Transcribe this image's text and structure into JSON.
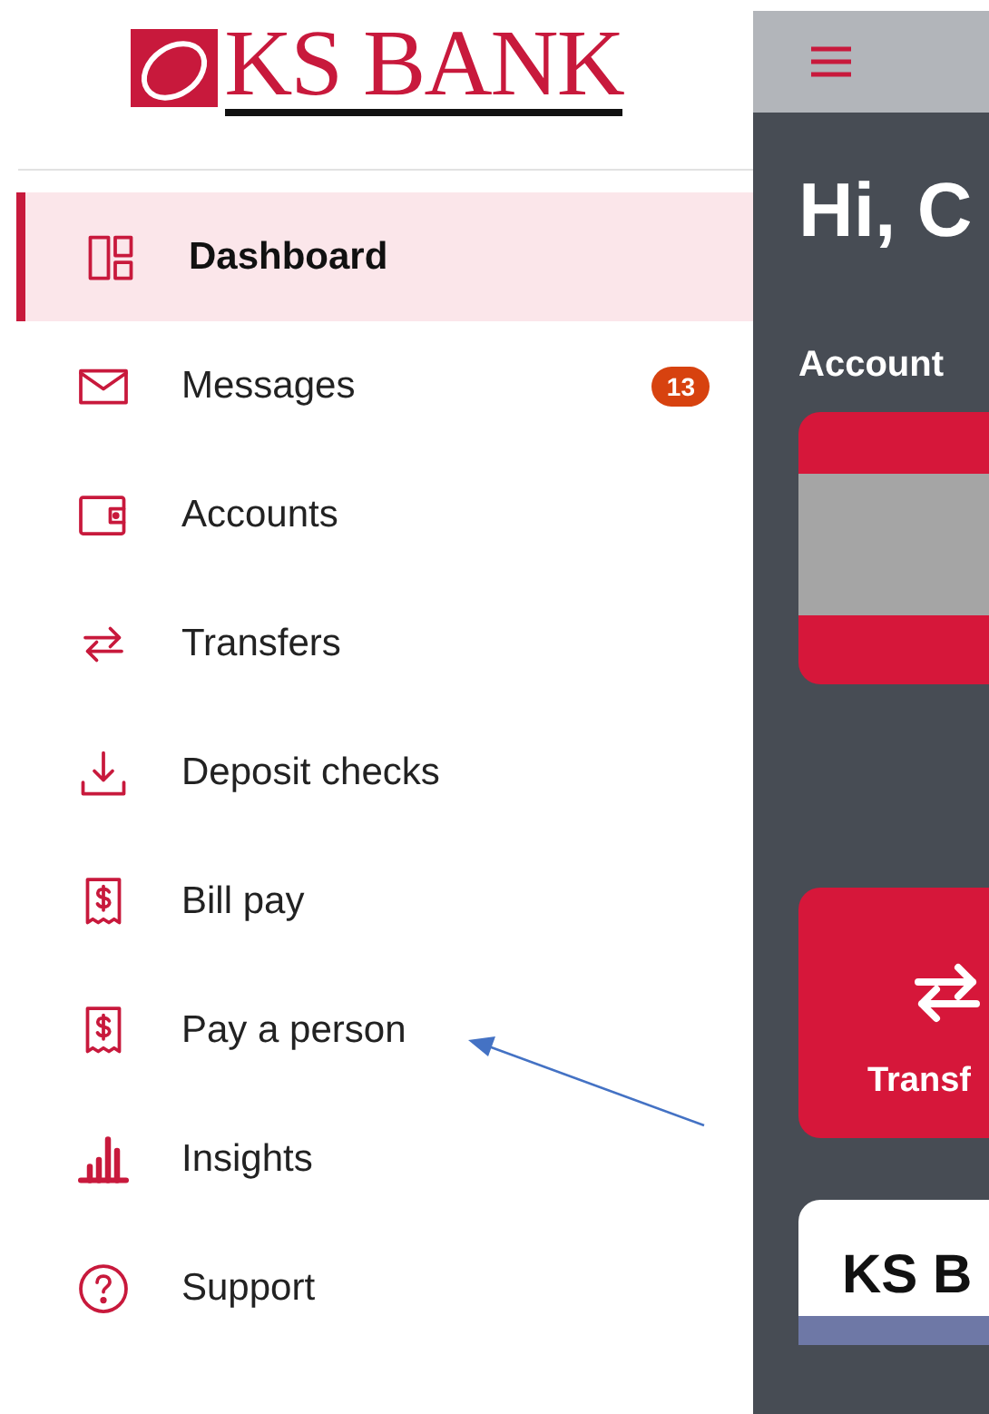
{
  "logo": {
    "text": "KS BANK"
  },
  "menu": [
    {
      "label": "Dashboard",
      "selected": true
    },
    {
      "label": "Messages",
      "selected": false,
      "badge": "13"
    },
    {
      "label": "Accounts",
      "selected": false
    },
    {
      "label": "Transfers",
      "selected": false
    },
    {
      "label": "Deposit checks",
      "selected": false
    },
    {
      "label": "Bill pay",
      "selected": false
    },
    {
      "label": "Pay a person",
      "selected": false
    },
    {
      "label": "Insights",
      "selected": false
    },
    {
      "label": "Support",
      "selected": false
    }
  ],
  "background_app": {
    "greeting": "Hi, C",
    "section_title": "Account",
    "action_button": {
      "label": "Transf"
    },
    "card_title": "KS B"
  }
}
